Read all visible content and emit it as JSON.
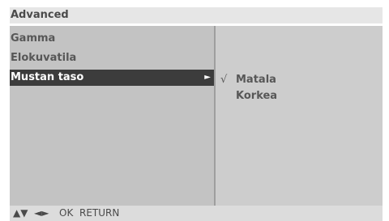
{
  "menu": {
    "title": "Advanced",
    "items": [
      {
        "label": "Gamma",
        "selected": false
      },
      {
        "label": "Elokuvatila",
        "selected": false
      },
      {
        "label": "Mustan taso",
        "selected": true,
        "submenu_indicator": "►"
      }
    ],
    "options": [
      {
        "label": "Matala",
        "checked": true,
        "check_mark": "√"
      },
      {
        "label": "Korkea",
        "checked": false,
        "check_mark": ""
      }
    ]
  },
  "help_bar": {
    "updown": "▲▼",
    "leftright": "◄►",
    "ok": "OK",
    "return": "RETURN"
  },
  "colors": {
    "left_panel": "#c3c3c3",
    "right_panel": "#cdcdcd",
    "selected_bg": "#3c3c3c",
    "text": "#575757"
  }
}
